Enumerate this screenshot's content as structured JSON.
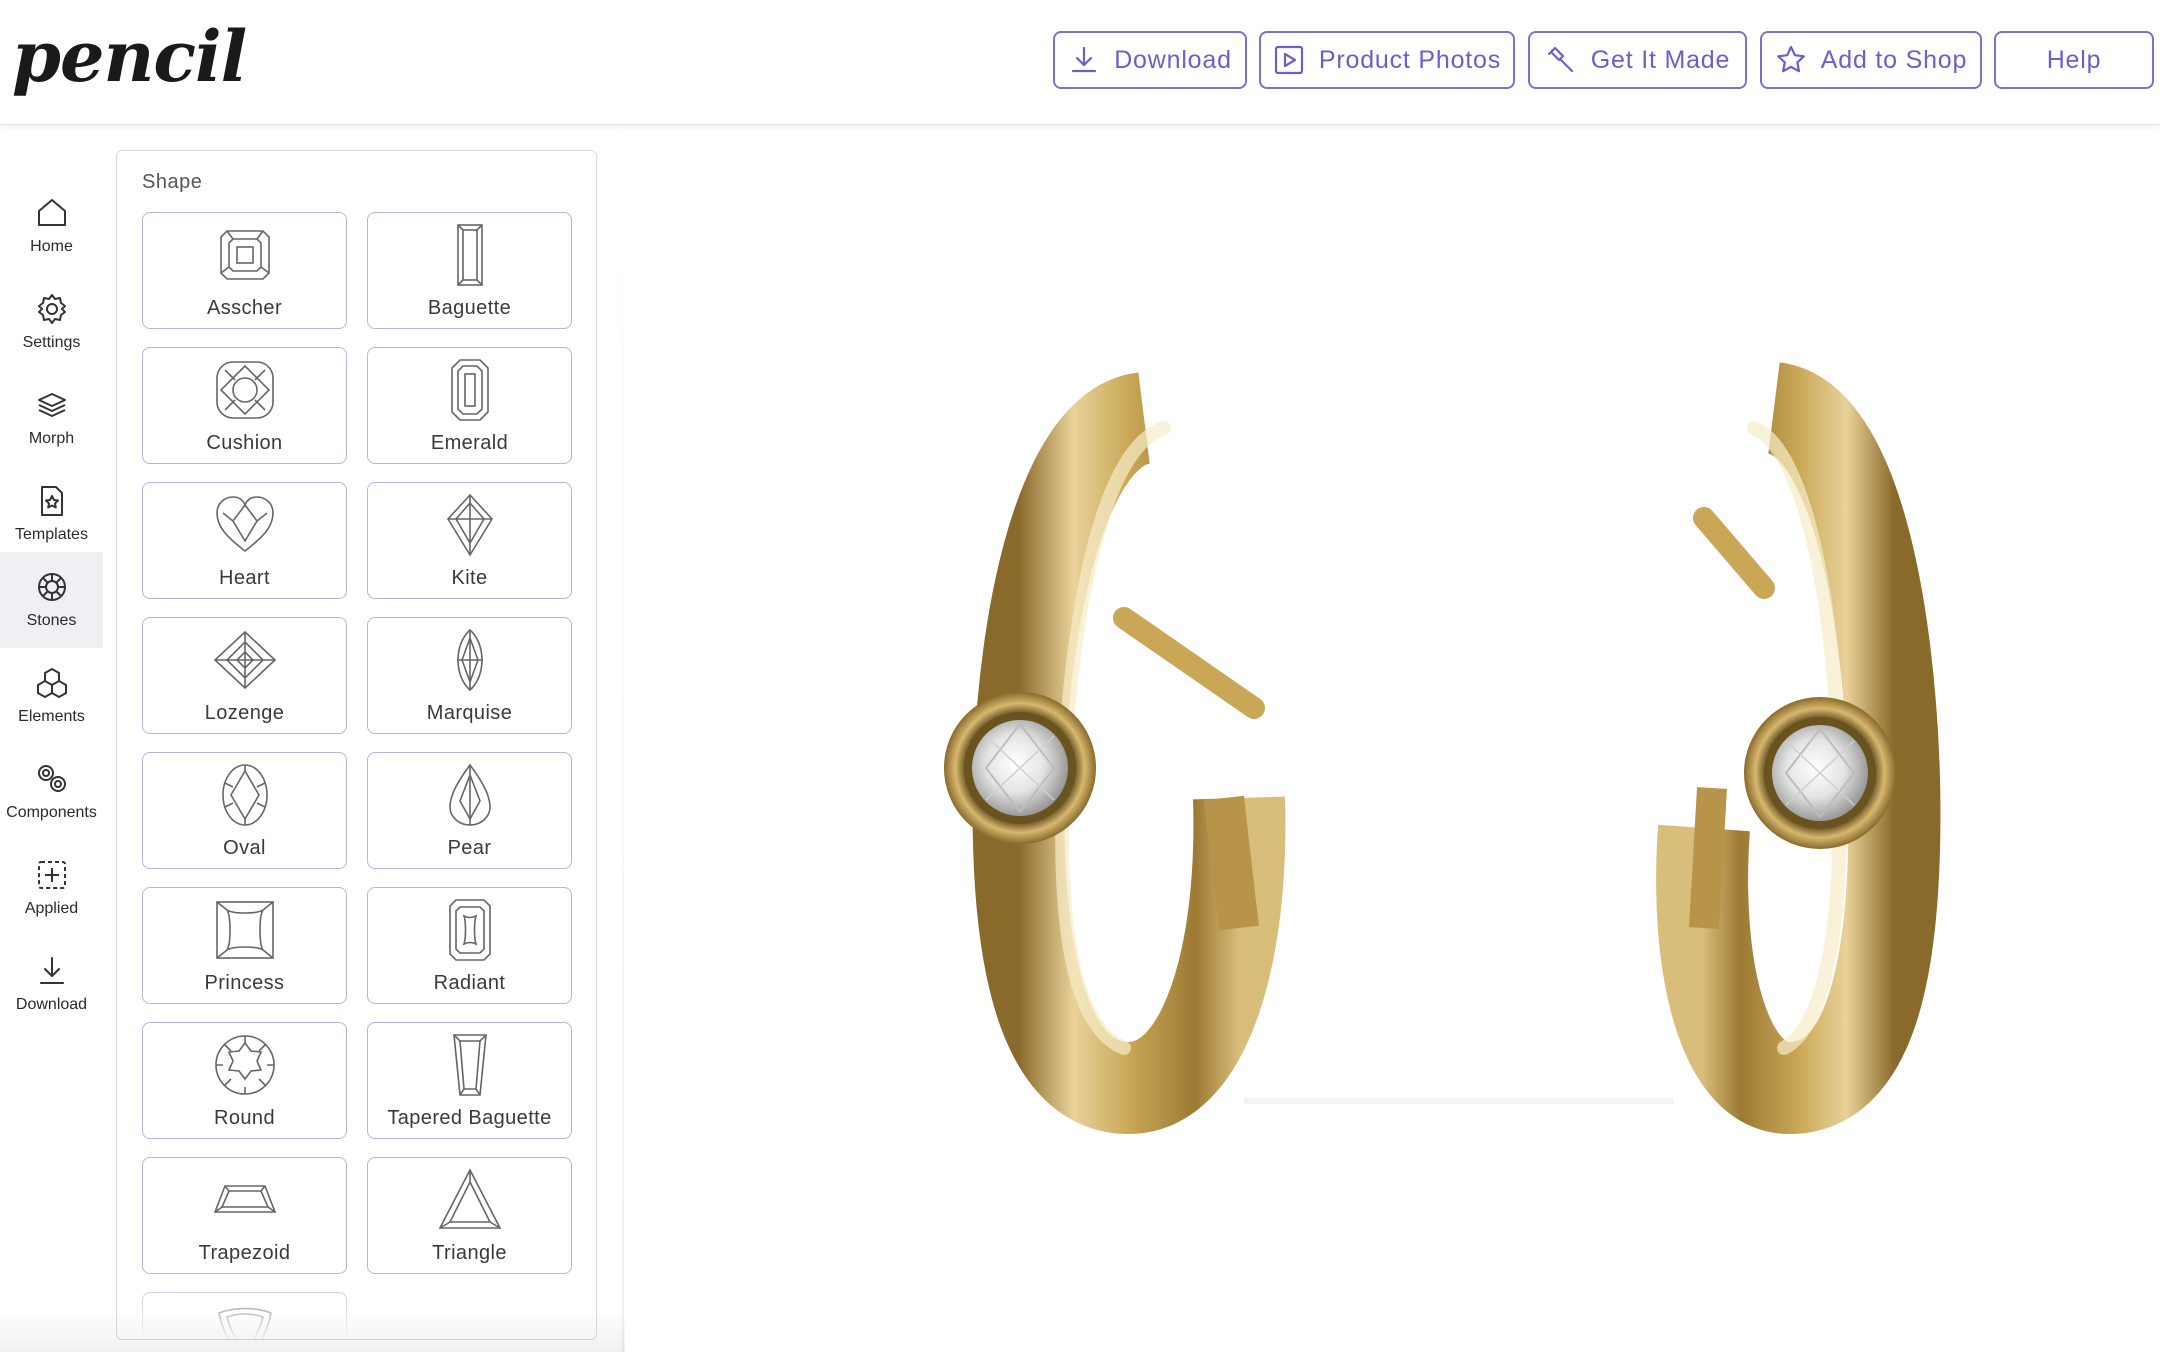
{
  "app": {
    "logo_text": "pencil"
  },
  "header": {
    "buttons": [
      {
        "label": "Download",
        "icon": "download-icon"
      },
      {
        "label": "Product Photos",
        "icon": "play-square-icon"
      },
      {
        "label": "Get It Made",
        "icon": "hammer-icon"
      },
      {
        "label": "Add to Shop",
        "icon": "star-icon"
      },
      {
        "label": "Help",
        "icon": ""
      }
    ]
  },
  "rail": {
    "items": [
      {
        "label": "Home",
        "icon": "home-icon"
      },
      {
        "label": "Settings",
        "icon": "gear-icon"
      },
      {
        "label": "Morph",
        "icon": "layers-icon"
      },
      {
        "label": "Templates",
        "icon": "template-star-icon"
      },
      {
        "label": "Stones",
        "icon": "stone-icon",
        "active": true
      },
      {
        "label": "Elements",
        "icon": "cubes-icon"
      },
      {
        "label": "Components",
        "icon": "gears-icon"
      },
      {
        "label": "Applied",
        "icon": "applied-plus-icon"
      },
      {
        "label": "Download",
        "icon": "download-icon"
      }
    ]
  },
  "panel": {
    "title": "Shape",
    "shapes": [
      {
        "label": "Asscher",
        "icon": "asscher-icon"
      },
      {
        "label": "Baguette",
        "icon": "baguette-icon"
      },
      {
        "label": "Cushion",
        "icon": "cushion-icon"
      },
      {
        "label": "Emerald",
        "icon": "emerald-icon"
      },
      {
        "label": "Heart",
        "icon": "heart-icon"
      },
      {
        "label": "Kite",
        "icon": "kite-icon"
      },
      {
        "label": "Lozenge",
        "icon": "lozenge-icon"
      },
      {
        "label": "Marquise",
        "icon": "marquise-icon"
      },
      {
        "label": "Oval",
        "icon": "oval-icon"
      },
      {
        "label": "Pear",
        "icon": "pear-icon"
      },
      {
        "label": "Princess",
        "icon": "princess-icon"
      },
      {
        "label": "Radiant",
        "icon": "radiant-icon"
      },
      {
        "label": "Round",
        "icon": "round-icon"
      },
      {
        "label": "Tapered Baguette",
        "icon": "tapered-baguette-icon"
      },
      {
        "label": "Trapezoid",
        "icon": "trapezoid-icon"
      },
      {
        "label": "Triangle",
        "icon": "triangle-icon"
      },
      {
        "label": "",
        "icon": "trillion-icon"
      }
    ]
  },
  "colors": {
    "accent": "#6b5fcf",
    "accent_border": "#7c6fd6",
    "card_border": "#b8b3e3",
    "gold": "#c9a756",
    "active_rail": "#eef0f3"
  }
}
